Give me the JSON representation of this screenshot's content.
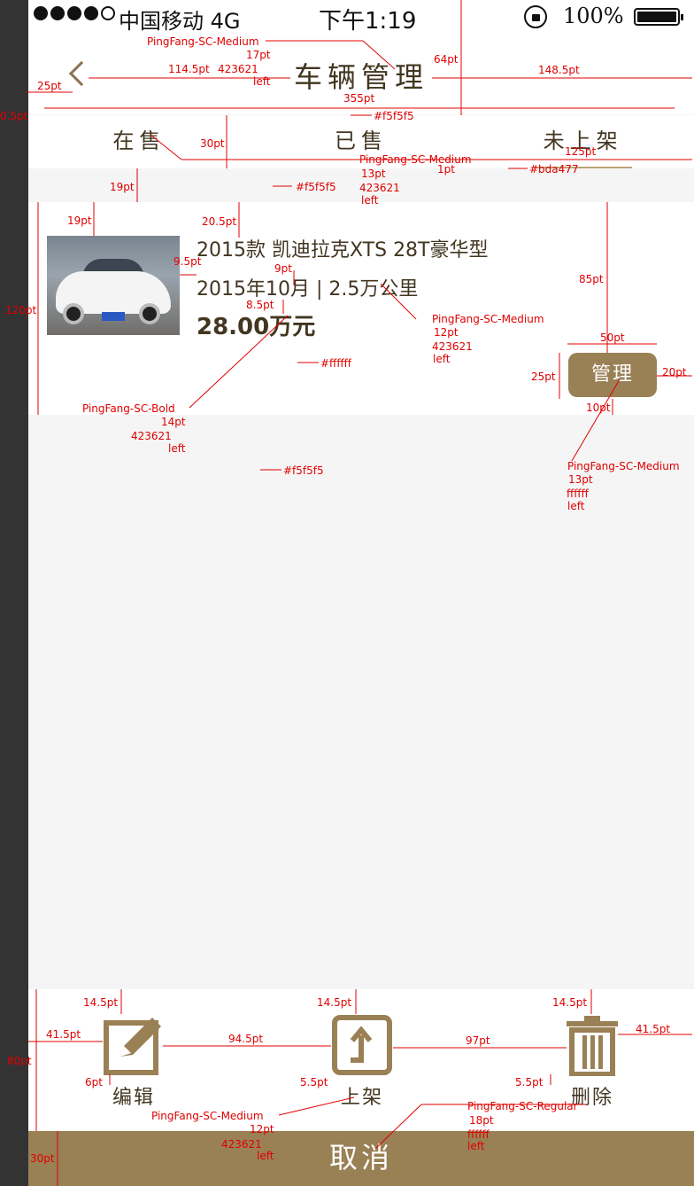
{
  "status_bar": {
    "carrier": "中国移动",
    "network": "4G",
    "time": "下午1:19",
    "battery_percent": "100%"
  },
  "nav": {
    "title": "车辆管理"
  },
  "tabs": [
    {
      "label": "在售",
      "active": false
    },
    {
      "label": "已售",
      "active": false
    },
    {
      "label": "未上架",
      "active": true
    }
  ],
  "listing": {
    "title": "2015款 凯迪拉克XTS 28T豪华型",
    "meta": "2015年10月 | 2.5万公里",
    "price": "28.00万元",
    "manage_label": "管理"
  },
  "actions": [
    {
      "label": "编辑",
      "icon": "edit-icon"
    },
    {
      "label": "上架",
      "icon": "shelve-up-icon"
    },
    {
      "label": "删除",
      "icon": "trash-icon"
    }
  ],
  "cancel_label": "取消",
  "colors": {
    "text": "#423621",
    "background": "#f5f5f5",
    "card": "#ffffff",
    "accent": "#bda477",
    "button": "#9a8055",
    "annotation": "#e00000"
  },
  "annotations": [
    {
      "id": "a01",
      "text": "PingFang-SC-Medium"
    },
    {
      "id": "a02",
      "text": "17pt"
    },
    {
      "id": "a03",
      "text": "114.5pt"
    },
    {
      "id": "a04",
      "text": "423621"
    },
    {
      "id": "a05",
      "text": "left"
    },
    {
      "id": "a06",
      "text": "64pt"
    },
    {
      "id": "a07",
      "text": "148.5pt"
    },
    {
      "id": "a08",
      "text": "25pt"
    },
    {
      "id": "a09",
      "text": "355pt"
    },
    {
      "id": "a10",
      "text": "0.5pt"
    },
    {
      "id": "a11",
      "text": "#f5f5f5"
    },
    {
      "id": "a12",
      "text": "30pt"
    },
    {
      "id": "a13",
      "text": "PingFang-SC-Medium"
    },
    {
      "id": "a14",
      "text": "13pt"
    },
    {
      "id": "a15",
      "text": "125pt"
    },
    {
      "id": "a16",
      "text": "1pt"
    },
    {
      "id": "a17",
      "text": "#bda477"
    },
    {
      "id": "a18",
      "text": "19pt"
    },
    {
      "id": "a19",
      "text": "#f5f5f5"
    },
    {
      "id": "a20",
      "text": "423621"
    },
    {
      "id": "a21",
      "text": "left"
    },
    {
      "id": "a22",
      "text": "19pt"
    },
    {
      "id": "a23",
      "text": "20.5pt"
    },
    {
      "id": "a24",
      "text": "9.5pt"
    },
    {
      "id": "a25",
      "text": "9pt"
    },
    {
      "id": "a26",
      "text": "85pt"
    },
    {
      "id": "a27",
      "text": "120pt"
    },
    {
      "id": "a28",
      "text": "8.5pt"
    },
    {
      "id": "a29",
      "text": "PingFang-SC-Medium"
    },
    {
      "id": "a30",
      "text": "12pt"
    },
    {
      "id": "a31",
      "text": "423621"
    },
    {
      "id": "a32",
      "text": "left"
    },
    {
      "id": "a33",
      "text": "50pt"
    },
    {
      "id": "a34",
      "text": "#ffffff"
    },
    {
      "id": "a35",
      "text": "25pt"
    },
    {
      "id": "a36",
      "text": "20pt"
    },
    {
      "id": "a37",
      "text": "10pt"
    },
    {
      "id": "a38",
      "text": "PingFang-SC-Bold"
    },
    {
      "id": "a39",
      "text": "14pt"
    },
    {
      "id": "a40",
      "text": "423621"
    },
    {
      "id": "a41",
      "text": "left"
    },
    {
      "id": "a42",
      "text": "PingFang-SC-Medium"
    },
    {
      "id": "a43",
      "text": "13pt"
    },
    {
      "id": "a44",
      "text": "ffffff"
    },
    {
      "id": "a45",
      "text": "left"
    },
    {
      "id": "a46",
      "text": "#f5f5f5"
    },
    {
      "id": "a47",
      "text": "14.5pt"
    },
    {
      "id": "a48",
      "text": "14.5pt"
    },
    {
      "id": "a49",
      "text": "14.5pt"
    },
    {
      "id": "a50",
      "text": "41.5pt"
    },
    {
      "id": "a51",
      "text": "94.5pt"
    },
    {
      "id": "a52",
      "text": "97pt"
    },
    {
      "id": "a53",
      "text": "41.5pt"
    },
    {
      "id": "a54",
      "text": "80pt"
    },
    {
      "id": "a55",
      "text": "6pt"
    },
    {
      "id": "a56",
      "text": "5.5pt"
    },
    {
      "id": "a57",
      "text": "5.5pt"
    },
    {
      "id": "a58",
      "text": "PingFang-SC-Medium"
    },
    {
      "id": "a59",
      "text": "12pt"
    },
    {
      "id": "a60",
      "text": "423621"
    },
    {
      "id": "a61",
      "text": "left"
    },
    {
      "id": "a62",
      "text": "PingFang-SC-Regular"
    },
    {
      "id": "a63",
      "text": "18pt"
    },
    {
      "id": "a64",
      "text": "ffffff"
    },
    {
      "id": "a65",
      "text": "left"
    },
    {
      "id": "a66",
      "text": "30pt"
    }
  ]
}
